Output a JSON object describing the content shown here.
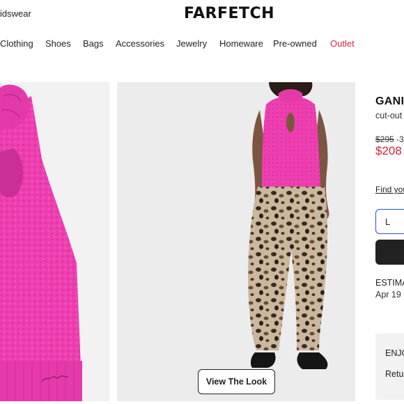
{
  "header": {
    "top_link": "idswear",
    "logo": "FARFETCH"
  },
  "nav": {
    "items": [
      {
        "label": "Clothing"
      },
      {
        "label": "Shoes"
      },
      {
        "label": "Bags"
      },
      {
        "label": "Accessories"
      },
      {
        "label": "Jewelry"
      },
      {
        "label": "Homeware"
      },
      {
        "label": "Pre-owned"
      },
      {
        "label": "Outlet"
      }
    ]
  },
  "gallery": {
    "left_image_name": "pink-sleeveless-knit-top-product-photo",
    "center_image_name": "model-wearing-pink-top-leopard-trousers",
    "view_look_label": "View The Look",
    "garment_logo_text": "GANNI"
  },
  "product": {
    "brand": "GANI",
    "description": "cut-out",
    "price_original": "$295",
    "price_discount": "-3",
    "price_sale": "$208",
    "size_guide_link": "Find you",
    "selected_size": "L",
    "estimated_label": "ESTIMA",
    "estimated_date": "Apr 19 -",
    "promo_line_1": "ENJO",
    "promo_line_2": "Retur"
  },
  "colors": {
    "accent_red": "#d4273e",
    "garment_pink": "#ee3fb0",
    "select_border": "#1f4fd6",
    "button_dark": "#222222"
  }
}
